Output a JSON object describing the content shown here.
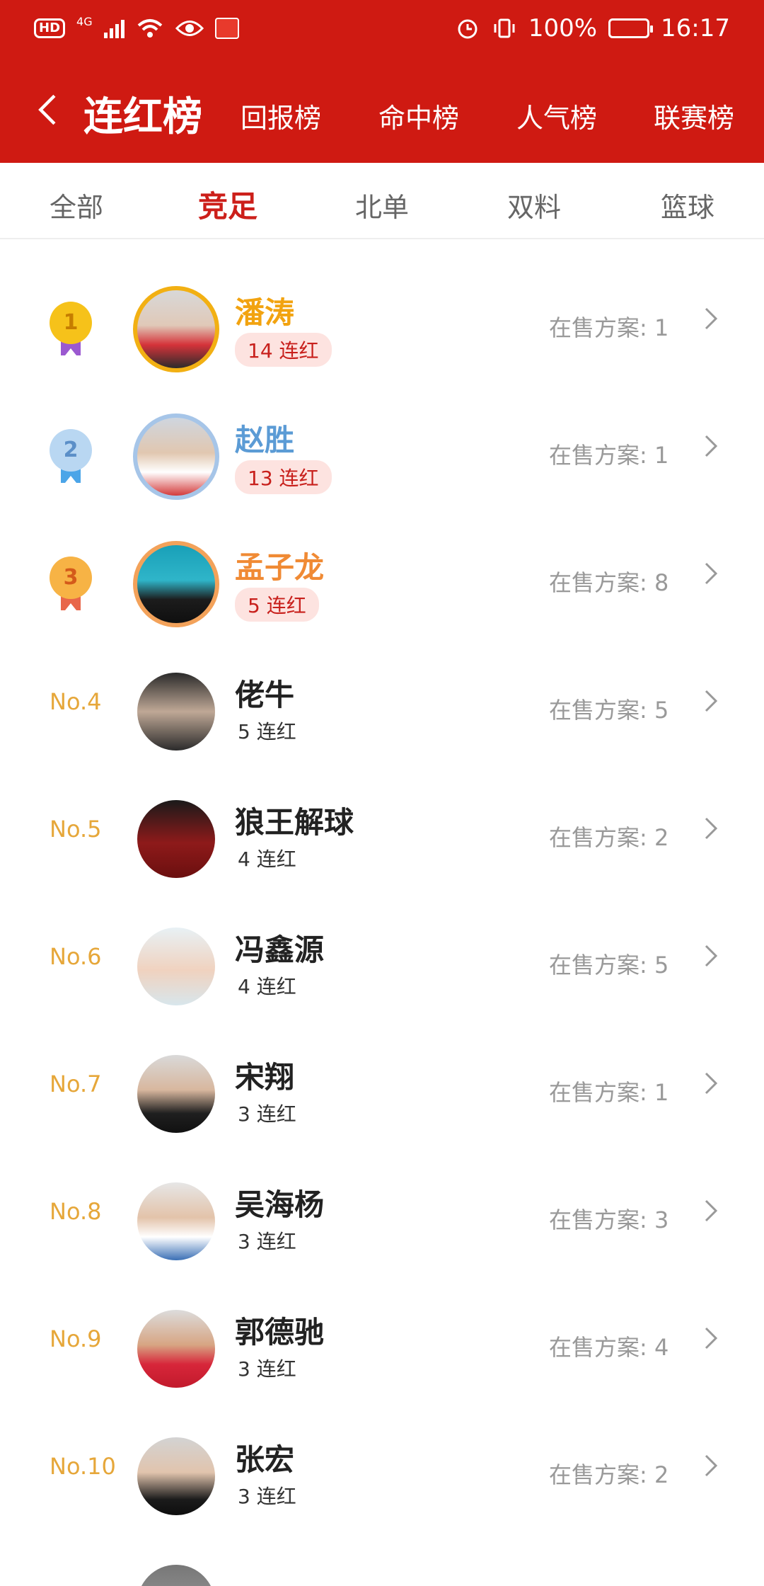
{
  "status": {
    "hd": "HD",
    "net": "4G",
    "battery": "100%",
    "time": "16:17"
  },
  "nav": {
    "title": "连红榜",
    "tabs": [
      "回报榜",
      "命中榜",
      "人气榜",
      "联赛榜"
    ]
  },
  "categories": {
    "items": [
      "全部",
      "竞足",
      "北单",
      "双料",
      "篮球"
    ],
    "active": "竞足"
  },
  "list": {
    "sale_label": "在售方案:",
    "items": [
      {
        "rank": "1",
        "name": "潘涛",
        "streak": "14 连红",
        "sale": "1"
      },
      {
        "rank": "2",
        "name": "赵胜",
        "streak": "13 连红",
        "sale": "1"
      },
      {
        "rank": "3",
        "name": "孟子龙",
        "streak": "5 连红",
        "sale": "8"
      },
      {
        "rank": "No.4",
        "name": "佬牛",
        "streak": "5 连红",
        "sale": "5"
      },
      {
        "rank": "No.5",
        "name": "狼王解球",
        "streak": "4 连红",
        "sale": "2"
      },
      {
        "rank": "No.6",
        "name": "冯鑫源",
        "streak": "4 连红",
        "sale": "5"
      },
      {
        "rank": "No.7",
        "name": "宋翔",
        "streak": "3 连红",
        "sale": "1"
      },
      {
        "rank": "No.8",
        "name": "吴海杨",
        "streak": "3 连红",
        "sale": "3"
      },
      {
        "rank": "No.9",
        "name": "郭德驰",
        "streak": "3 连红",
        "sale": "4"
      },
      {
        "rank": "No.10",
        "name": "张宏",
        "streak": "3 连红",
        "sale": "2"
      }
    ]
  },
  "colors": {
    "header_red": "#cf1a12",
    "gold": "#f2b013",
    "silver_blue": "#5b9bd5",
    "bronze_orange": "#f08a34",
    "rank_text": "#e6a73a"
  }
}
